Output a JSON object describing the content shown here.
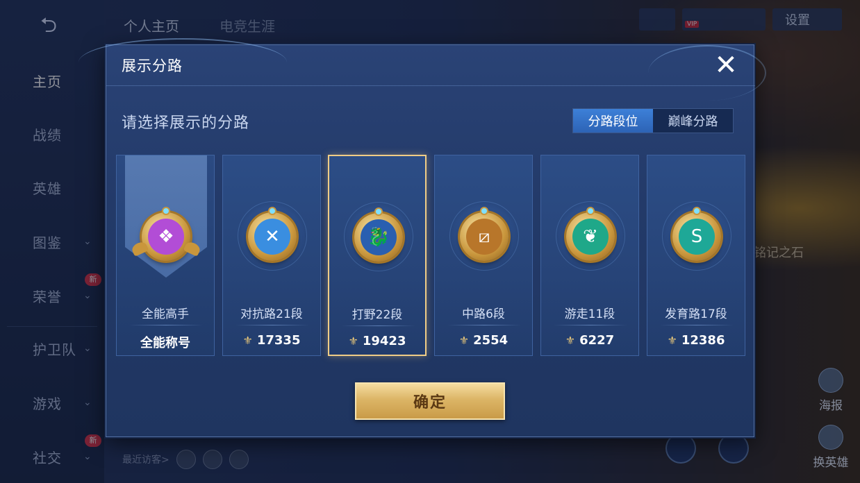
{
  "background": {
    "back_label": "⮌",
    "top_tabs": [
      "个人主页",
      "电竞生涯"
    ],
    "nav": [
      {
        "label": "主页",
        "active": true
      },
      {
        "label": "战绩"
      },
      {
        "label": "英雄"
      },
      {
        "label": "图鉴",
        "chevron": true
      },
      {
        "label": "荣誉",
        "chevron": true,
        "badge": "新"
      },
      {
        "label": "护卫队",
        "chevron": true
      },
      {
        "label": "游戏",
        "chevron": true
      },
      {
        "label": "社交",
        "chevron": true,
        "badge": "新"
      }
    ],
    "settings_label": "设置",
    "vip_label": "VIP",
    "recent_visitors_label": "最近访客>",
    "side_text": "铭记之石",
    "side_buttons": [
      "海报",
      "换英雄"
    ]
  },
  "dialog": {
    "title": "展示分路",
    "close_icon": "close-icon",
    "subtitle": "请选择展示的分路",
    "segment": {
      "options": [
        "分路段位",
        "巅峰分路"
      ],
      "selected_index": 0
    },
    "cards": [
      {
        "name": "全能高手",
        "value": "全能称号",
        "emblem_color": "#b24dd6",
        "icon": "all-round-emblem-icon",
        "glyph": "❖"
      },
      {
        "name": "对抗路21段",
        "value": "17335",
        "emblem_color": "#3a8ee0",
        "icon": "clash-lane-emblem-icon",
        "glyph": "✕"
      },
      {
        "name": "打野22段",
        "value": "19423",
        "emblem_color": "#2a5fb0",
        "icon": "jungle-dragon-emblem-icon",
        "glyph": "🐉",
        "selected": true
      },
      {
        "name": "中路6段",
        "value": "2554",
        "emblem_color": "#b8762a",
        "icon": "mid-lane-emblem-icon",
        "glyph": "⧄"
      },
      {
        "name": "游走11段",
        "value": "6227",
        "emblem_color": "#1fa889",
        "icon": "roam-wings-emblem-icon",
        "glyph": "❦"
      },
      {
        "name": "发育路17段",
        "value": "12386",
        "emblem_color": "#1ea897",
        "icon": "farm-lane-emblem-icon",
        "glyph": "S"
      }
    ],
    "score_icon": "peak-score-icon",
    "confirm_label": "确定"
  }
}
